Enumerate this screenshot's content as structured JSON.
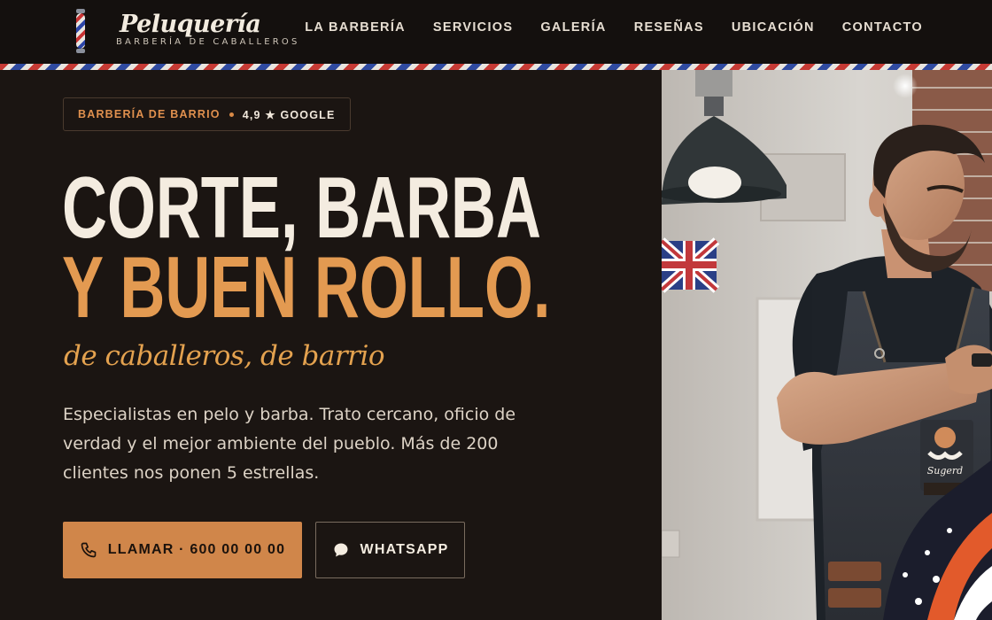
{
  "brand": {
    "name": "Peluquería",
    "tagline": "BARBERÍA DE CABALLEROS",
    "logo_icon": "barber-pole-icon"
  },
  "nav": {
    "items": [
      "LA BARBERÍA",
      "SERVICIOS",
      "GALERÍA",
      "RESEÑAS",
      "UBICACIÓN",
      "CONTACTO"
    ]
  },
  "hero": {
    "badge": {
      "label": "BARBERÍA DE BARRIO",
      "rating": "4,9 ★ GOOGLE"
    },
    "title_line1": "CORTE, BARBA",
    "title_line2": "Y BUEN ROLLO.",
    "script": "de caballeros, de barrio",
    "description": "Especialistas en pelo y barba. Trato cercano, oficio de verdad y el mejor ambiente del pueblo. Más de 200 clientes nos ponen 5 estrellas.",
    "call_button": "LLAMAR · 600 00 00 00",
    "whatsapp_button": "WHATSAPP",
    "call_icon": "phone-icon",
    "whatsapp_icon": "chat-bubble-icon"
  },
  "photo": {
    "apron_logo": "Sugerd"
  },
  "colors": {
    "background": "#1b1512",
    "accent": "#d0864a",
    "accent_text": "#e39a51",
    "cream": "#f4ece0",
    "stripe_red": "#c63a34",
    "stripe_blue": "#2f4aa0"
  }
}
